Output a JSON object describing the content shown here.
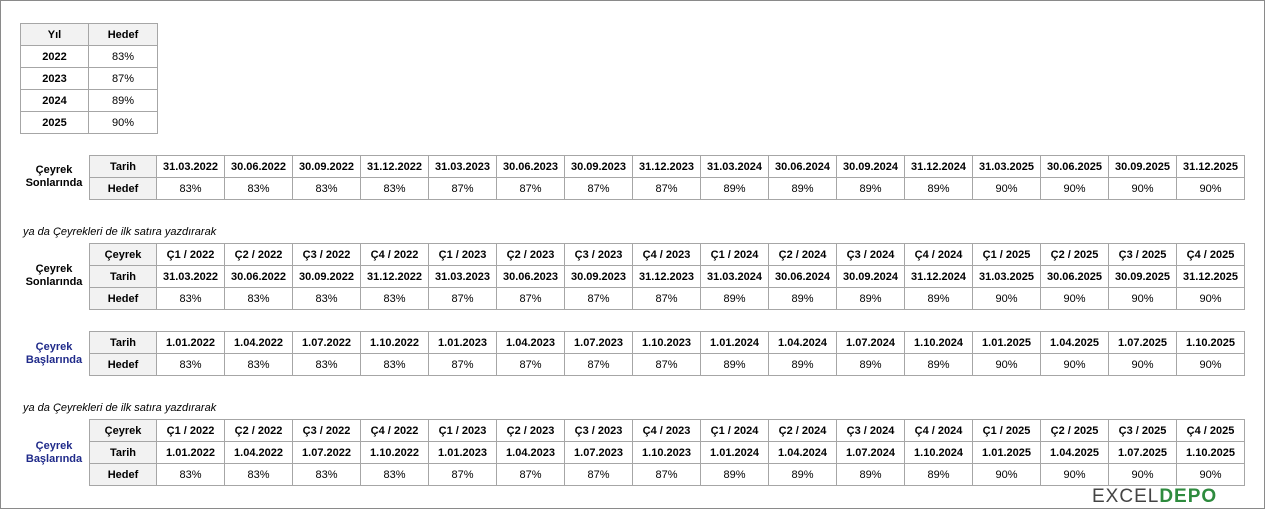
{
  "target_table": {
    "headers": [
      "Yıl",
      "Hedef"
    ],
    "rows": [
      {
        "year": "2022",
        "target": "83%"
      },
      {
        "year": "2023",
        "target": "87%"
      },
      {
        "year": "2024",
        "target": "89%"
      },
      {
        "year": "2025",
        "target": "90%"
      }
    ]
  },
  "labels": {
    "quarter_ends": "Çeyrek Sonlarında",
    "quarter_starts": "Çeyrek Başlarında",
    "note": "ya da Çeyrekleri de ilk satıra yazdırarak",
    "row_quarter": "Çeyrek",
    "row_date": "Tarih",
    "row_target": "Hedef"
  },
  "quarters": [
    "Ç1 / 2022",
    "Ç2 / 2022",
    "Ç3 / 2022",
    "Ç4 / 2022",
    "Ç1 / 2023",
    "Ç2 / 2023",
    "Ç3 / 2023",
    "Ç4 / 2023",
    "Ç1 / 2024",
    "Ç2 / 2024",
    "Ç3 / 2024",
    "Ç4 / 2024",
    "Ç1 / 2025",
    "Ç2 / 2025",
    "Ç3 / 2025",
    "Ç4 / 2025"
  ],
  "end_dates": [
    "31.03.2022",
    "30.06.2022",
    "30.09.2022",
    "31.12.2022",
    "31.03.2023",
    "30.06.2023",
    "30.09.2023",
    "31.12.2023",
    "31.03.2024",
    "30.06.2024",
    "30.09.2024",
    "31.12.2024",
    "31.03.2025",
    "30.06.2025",
    "30.09.2025",
    "31.12.2025"
  ],
  "start_dates": [
    "1.01.2022",
    "1.04.2022",
    "1.07.2022",
    "1.10.2022",
    "1.01.2023",
    "1.04.2023",
    "1.07.2023",
    "1.10.2023",
    "1.01.2024",
    "1.04.2024",
    "1.07.2024",
    "1.10.2024",
    "1.01.2025",
    "1.04.2025",
    "1.07.2025",
    "1.10.2025"
  ],
  "targets": [
    "83%",
    "83%",
    "83%",
    "83%",
    "87%",
    "87%",
    "87%",
    "87%",
    "89%",
    "89%",
    "89%",
    "89%",
    "90%",
    "90%",
    "90%",
    "90%"
  ],
  "logo": {
    "text_a": "EXCEL",
    "text_b": "DEPO"
  }
}
